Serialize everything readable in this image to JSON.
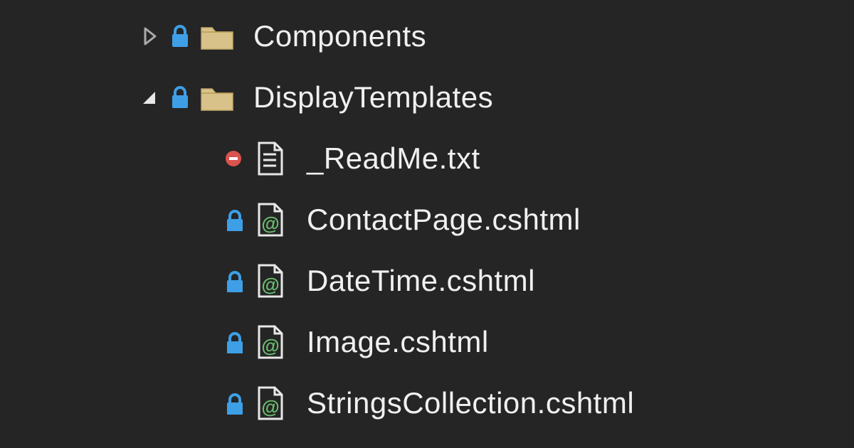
{
  "tree": {
    "folders": [
      {
        "label": "Components",
        "expanded": false
      },
      {
        "label": "DisplayTemplates",
        "expanded": true
      }
    ],
    "files": [
      {
        "label": "_ReadMe.txt",
        "type": "txt",
        "status": "blocked"
      },
      {
        "label": "ContactPage.cshtml",
        "type": "cshtml",
        "status": "locked"
      },
      {
        "label": "DateTime.cshtml",
        "type": "cshtml",
        "status": "locked"
      },
      {
        "label": "Image.cshtml",
        "type": "cshtml",
        "status": "locked"
      },
      {
        "label": "StringsCollection.cshtml",
        "type": "cshtml",
        "status": "locked"
      }
    ]
  },
  "colors": {
    "lock": "#3e9fe6",
    "folder_fill": "#d8c28a",
    "folder_stroke": "#e8d89f",
    "file_stroke": "#e8e8e8",
    "at_green": "#6abf6e",
    "minus_red": "#d9534f"
  }
}
